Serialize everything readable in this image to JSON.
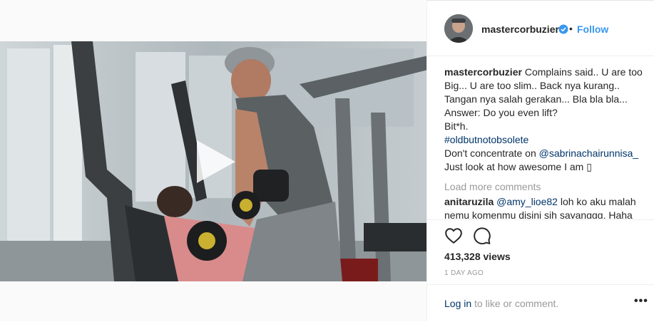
{
  "header": {
    "username": "mastercorbuzier",
    "separator": "•",
    "follow_label": "Follow"
  },
  "caption": {
    "username": "mastercorbuzier",
    "lines": [
      "Complains said.. U are too",
      "Big... U are too slim.. Back nya kurang..",
      "Tangan nya salah gerakan... Bla bla bla...",
      "Answer: Do you even lift?",
      "Bit*h."
    ],
    "hashtag": "#oldbutnotobsolete",
    "mention_prefix": "Don't concentrate on ",
    "mention": "@sabrinachairunnisa_",
    "last_line": "Just look at how awesome I am ▯"
  },
  "load_more_label": "Load more comments",
  "comment": {
    "username": "anitaruzila",
    "mention": "@amy_lioe82",
    "text": " loh ko aku malah nemu komenmu disini sih sayanggg. Haha"
  },
  "views_label": "413,328 views",
  "age_label": "1 DAY AGO",
  "footer": {
    "login_label": "Log in",
    "login_suffix": " to like or comment.",
    "more_label": "•••"
  },
  "colors": {
    "accent": "#3897f0",
    "link": "#003569",
    "muted": "#999999"
  },
  "icons": [
    "play-icon",
    "verified-badge-icon",
    "heart-icon",
    "comment-icon",
    "more-options-icon"
  ]
}
